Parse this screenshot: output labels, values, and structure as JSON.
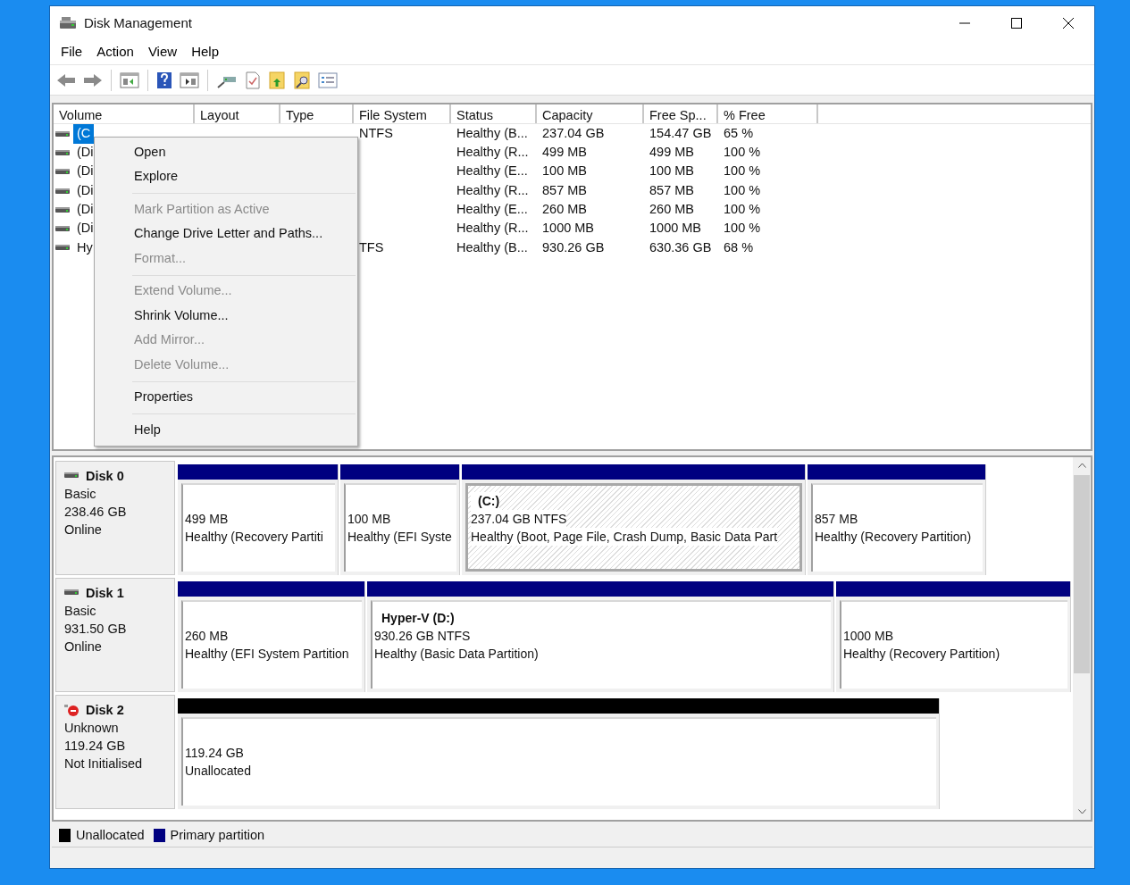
{
  "window": {
    "title": "Disk Management"
  },
  "menu": [
    "File",
    "Action",
    "View",
    "Help"
  ],
  "volume_table": {
    "columns": [
      "Volume",
      "Layout",
      "Type",
      "File System",
      "Status",
      "Capacity",
      "Free Sp...",
      "% Free"
    ],
    "rows": [
      {
        "selected": true,
        "cells": [
          "(C",
          "",
          "",
          "NTFS",
          "Healthy (B...",
          "237.04 GB",
          "154.47 GB",
          "65 %"
        ]
      },
      {
        "selected": false,
        "cells": [
          "(Di",
          "",
          "",
          "",
          "Healthy (R...",
          "499 MB",
          "499 MB",
          "100 %"
        ]
      },
      {
        "selected": false,
        "cells": [
          "(Di",
          "",
          "",
          "",
          "Healthy (E...",
          "100 MB",
          "100 MB",
          "100 %"
        ]
      },
      {
        "selected": false,
        "cells": [
          "(Di",
          "",
          "",
          "",
          "Healthy (R...",
          "857 MB",
          "857 MB",
          "100 %"
        ]
      },
      {
        "selected": false,
        "cells": [
          "(Di",
          "",
          "",
          "",
          "Healthy (E...",
          "260 MB",
          "260 MB",
          "100 %"
        ]
      },
      {
        "selected": false,
        "cells": [
          "(Di",
          "",
          "",
          "",
          "Healthy (R...",
          "1000 MB",
          "1000 MB",
          "100 %"
        ]
      },
      {
        "selected": false,
        "cells": [
          "Hy",
          "",
          "",
          "TFS",
          "Healthy (B...",
          "930.26 GB",
          "630.36 GB",
          "68 %"
        ]
      }
    ]
  },
  "context_menu": [
    {
      "kind": "item",
      "label": "Open",
      "disabled": false
    },
    {
      "kind": "item",
      "label": "Explore",
      "disabled": false
    },
    {
      "kind": "separator"
    },
    {
      "kind": "item",
      "label": "Mark Partition as Active",
      "disabled": true
    },
    {
      "kind": "item",
      "label": "Change Drive Letter and Paths...",
      "disabled": false
    },
    {
      "kind": "item",
      "label": "Format...",
      "disabled": true
    },
    {
      "kind": "separator"
    },
    {
      "kind": "item",
      "label": "Extend Volume...",
      "disabled": true
    },
    {
      "kind": "item",
      "label": "Shrink Volume...",
      "disabled": false
    },
    {
      "kind": "item",
      "label": "Add Mirror...",
      "disabled": true
    },
    {
      "kind": "item",
      "label": "Delete Volume...",
      "disabled": true
    },
    {
      "kind": "separator"
    },
    {
      "kind": "item",
      "label": "Properties",
      "disabled": false
    },
    {
      "kind": "separator"
    },
    {
      "kind": "item",
      "label": "Help",
      "disabled": false
    }
  ],
  "disks": [
    {
      "name": "Disk 0",
      "kind": "online",
      "type": "Basic",
      "size": "238.46 GB",
      "status": "Online",
      "partitions": [
        {
          "kind": "primary",
          "selected": false,
          "size": "499 MB",
          "status": "Healthy (Recovery Partiti"
        },
        {
          "kind": "primary",
          "selected": false,
          "size": "100 MB",
          "status": "Healthy (EFI Syste"
        },
        {
          "kind": "primary",
          "selected": true,
          "label": "(C:)",
          "size": "237.04 GB NTFS",
          "status": "Healthy (Boot, Page File, Crash Dump, Basic Data Part"
        },
        {
          "kind": "primary",
          "selected": false,
          "size": "857 MB",
          "status": "Healthy (Recovery Partition)"
        }
      ]
    },
    {
      "name": "Disk 1",
      "kind": "online",
      "type": "Basic",
      "size": "931.50 GB",
      "status": "Online",
      "partitions": [
        {
          "kind": "primary",
          "selected": false,
          "size": "260 MB",
          "status": "Healthy (EFI System Partition"
        },
        {
          "kind": "primary",
          "selected": false,
          "label": "Hyper-V  (D:)",
          "size": "930.26 GB NTFS",
          "status": "Healthy (Basic Data Partition)"
        },
        {
          "kind": "primary",
          "selected": false,
          "size": "1000 MB",
          "status": "Healthy (Recovery Partition)"
        }
      ]
    },
    {
      "name": "Disk 2",
      "kind": "error",
      "type": "Unknown",
      "size": "119.24 GB",
      "status": "Not Initialised",
      "partitions": [
        {
          "kind": "unallocated",
          "selected": false,
          "size": "119.24 GB",
          "status": "Unallocated"
        }
      ]
    }
  ],
  "legend": [
    {
      "label": "Unallocated",
      "color": "#000000"
    },
    {
      "label": "Primary partition",
      "color": "#000080"
    }
  ]
}
